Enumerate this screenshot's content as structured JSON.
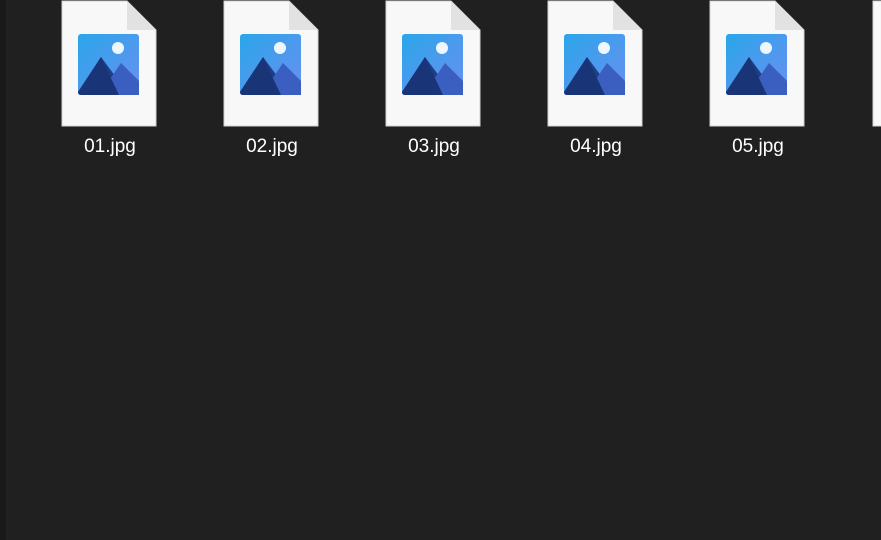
{
  "window": {
    "background_color": "#202020"
  },
  "files": [
    {
      "name": "01.jpg",
      "icon": "image-file-icon"
    },
    {
      "name": "02.jpg",
      "icon": "image-file-icon"
    },
    {
      "name": "03.jpg",
      "icon": "image-file-icon"
    },
    {
      "name": "04.jpg",
      "icon": "image-file-icon"
    },
    {
      "name": "05.jpg",
      "icon": "image-file-icon"
    }
  ],
  "partial_file": {
    "icon": "image-file-icon"
  }
}
